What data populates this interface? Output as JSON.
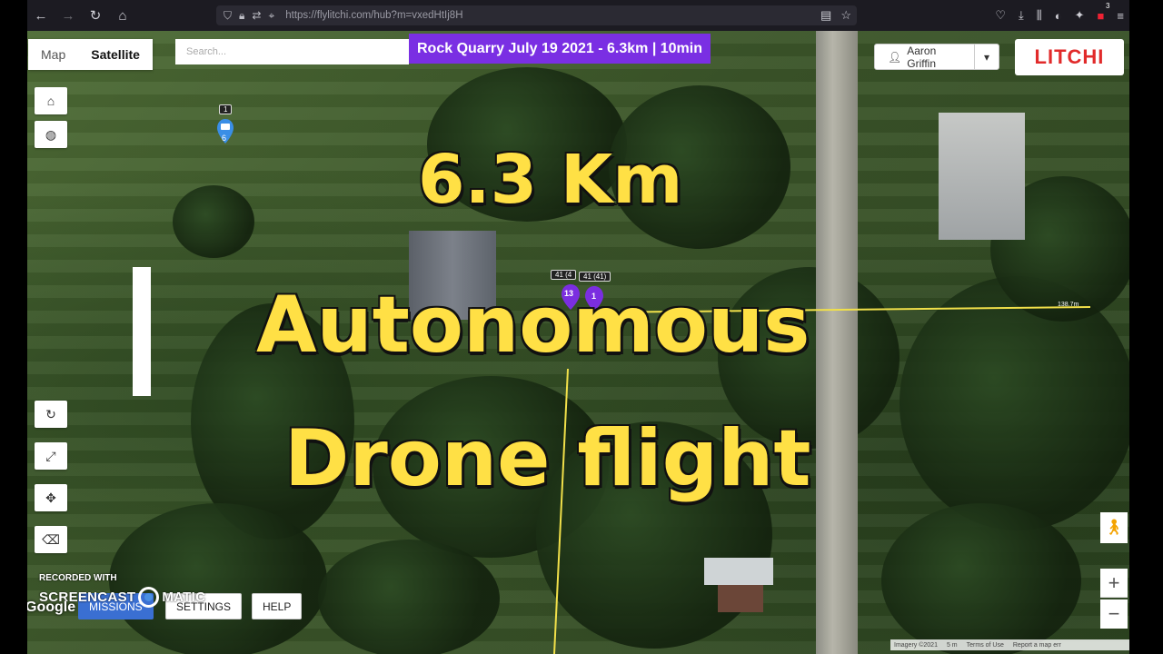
{
  "browser": {
    "url": "https://flylitchi.com/hub?m=vxedHtIj8H",
    "badge_count": "3"
  },
  "map": {
    "type_tabs": [
      {
        "label": "Map",
        "selected": false
      },
      {
        "label": "Satellite",
        "selected": true
      }
    ],
    "search_placeholder": "Search...",
    "mission_title": "Rock Quarry July 19 2021 - 6.3km | 10min",
    "user_name": "Aaron Griffin",
    "logo": "LITCHI",
    "waypoint_top": {
      "chip": "1",
      "number": "6"
    },
    "waypoint_chip_a": "41 (4",
    "waypoint_chip_b": "41 (41)",
    "waypoint_13": "13",
    "waypoint_1": "1",
    "distance_label": "138.7m",
    "buttons": {
      "missions": "MISSIONS",
      "settings": "SETTINGS",
      "help": "HELP"
    },
    "attribution": [
      "Imagery ©2021",
      "5 m",
      "Terms of Use",
      "Report a map err"
    ],
    "google": "Google"
  },
  "recorder": {
    "line1": "RECORDED WITH",
    "line2a": "SCREENCAST",
    "line2b": "MATIC"
  },
  "overlay": {
    "line1": "6.3 Km",
    "line2": "Autonomous",
    "line3": "Drone flight"
  }
}
